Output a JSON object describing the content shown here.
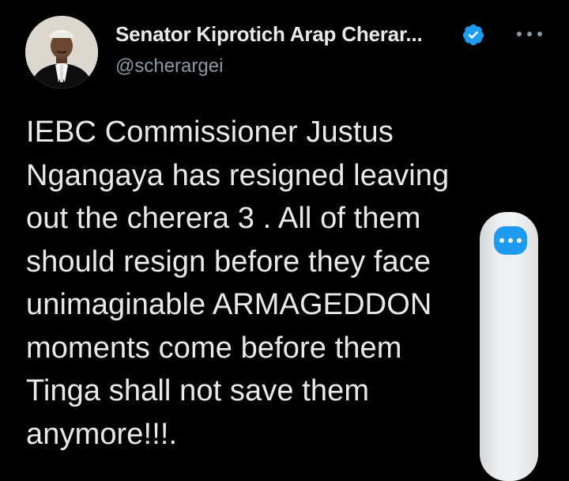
{
  "tweet": {
    "display_name": "Senator Kiprotich Arap Cherar...",
    "handle": "@scherargei",
    "text": "IEBC Commissioner Justus\nNgangaya has resigned leaving\nout the cherera 3 . All of them\nshould resign before they face\nunimaginable ARMAGEDDON\nmoments come before them\nTinga shall not save them\nanymore!!!."
  },
  "icons": {
    "verified": "verified-badge-icon",
    "more": "more-options-icon",
    "panel_more": "more-dots-icon"
  },
  "colors": {
    "background": "#000000",
    "text_primary": "#e7e9ea",
    "text_secondary": "#8b98a5",
    "accent": "#1d9bf0"
  }
}
